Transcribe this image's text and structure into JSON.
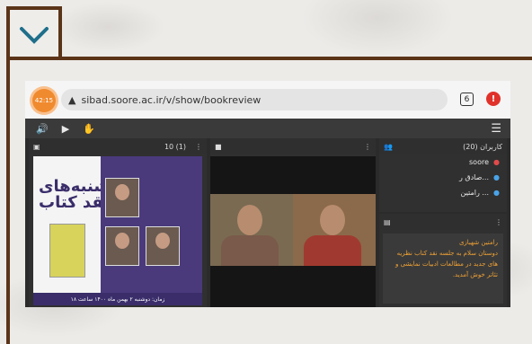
{
  "browser": {
    "badge_time": "42:15",
    "url": "sibad.soore.ac.ir/v/show/bookreview",
    "tab_count": "6",
    "alert_icon": "alert-icon"
  },
  "toolbar": {
    "icons": [
      "speaker-icon",
      "presentation-icon",
      "hand-icon",
      "menu-icon"
    ]
  },
  "presentation": {
    "page": "10 (1)",
    "slide_title": "دوشنبه‌های نقد کتاب",
    "footer": "زمان: دوشنبه ۲ بهمن ماه ۱۴۰۰ ساعت ۱۸"
  },
  "users": {
    "title": "کاربران (20)",
    "list": [
      {
        "name": "soore",
        "role": "host"
      },
      {
        "name": "صادق ر...",
        "role": "user"
      },
      {
        "name": "رامتین ...",
        "role": "user"
      }
    ]
  },
  "chat": {
    "author": "رامتین شهبازی",
    "message": "دوستان سلام به جلسه نقد کتاب نظریه های جدید در مطالعات ادبیات نمایشی و تئاتر خوش آمدید."
  },
  "colors": {
    "frame": "#5b3418",
    "toggle_icon": "#1f6f8b",
    "chat_text": "#f0a236",
    "host": "#e24a4a",
    "user": "#4aa3e8"
  }
}
